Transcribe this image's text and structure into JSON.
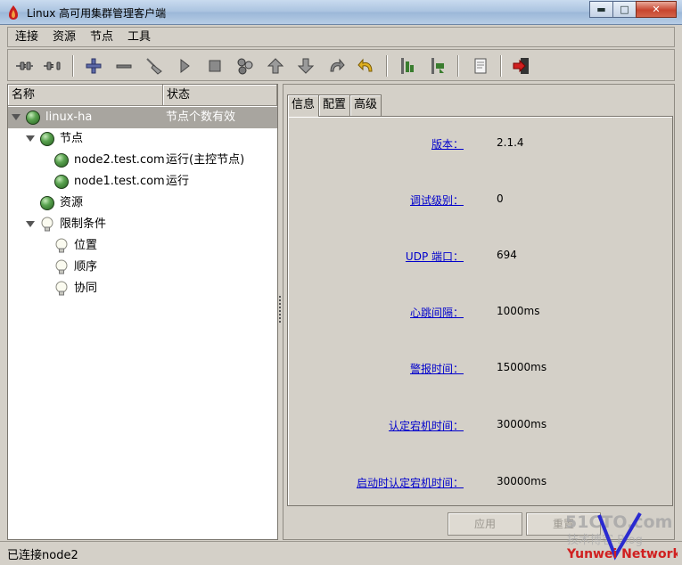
{
  "window": {
    "title": "Linux 高可用集群管理客户端",
    "minimize": "▬",
    "maximize": "□",
    "close": "✕"
  },
  "menu": [
    "连接",
    "资源",
    "节点",
    "工具"
  ],
  "toolbar_icons": [
    "connect-icon",
    "disconnect-icon",
    "add-icon",
    "remove-icon",
    "cleanup-icon",
    "start-icon",
    "stop-icon",
    "migrate-icon",
    "move-up-icon",
    "move-down-icon",
    "redo-icon",
    "undo-icon",
    "standby-icon",
    "active-icon",
    "view-log-icon",
    "exit-icon"
  ],
  "tree": {
    "col_name": "名称",
    "col_status": "状态",
    "rows": [
      {
        "label": "linux-ha",
        "status": "节点个数有效",
        "level": 0,
        "icon": "green-ball",
        "expanded": true,
        "selected": true
      },
      {
        "label": "节点",
        "status": "",
        "level": 1,
        "icon": "green-ball",
        "expanded": true
      },
      {
        "label": "node2.test.com",
        "status": "运行(主控节点)",
        "level": 2,
        "icon": "green-ball"
      },
      {
        "label": "node1.test.com",
        "status": "运行",
        "level": 2,
        "icon": "green-ball"
      },
      {
        "label": "资源",
        "status": "",
        "level": 1,
        "icon": "green-ball"
      },
      {
        "label": "限制条件",
        "status": "",
        "level": 1,
        "icon": "bulb",
        "expanded": true
      },
      {
        "label": "位置",
        "status": "",
        "level": 2,
        "icon": "bulb"
      },
      {
        "label": "顺序",
        "status": "",
        "level": 2,
        "icon": "bulb"
      },
      {
        "label": "协同",
        "status": "",
        "level": 2,
        "icon": "bulb"
      }
    ]
  },
  "tabs": [
    {
      "label": "信息",
      "active": true
    },
    {
      "label": "配置",
      "active": false
    },
    {
      "label": "高级",
      "active": false
    }
  ],
  "properties": [
    {
      "label": "版本：",
      "value": "2.1.4"
    },
    {
      "label": "调试级别：",
      "value": "0"
    },
    {
      "label": "UDP 端口：",
      "value": "694"
    },
    {
      "label": "心跳间隔：",
      "value": "1000ms"
    },
    {
      "label": "警报时间：",
      "value": "15000ms"
    },
    {
      "label": "认定宕机时间：",
      "value": "30000ms"
    },
    {
      "label": "启动时认定宕机时间：",
      "value": "30000ms"
    }
  ],
  "buttons": {
    "apply": "应用",
    "reset": "重置"
  },
  "status": "已连接node2",
  "watermark": {
    "line1": "51CTO.com",
    "line2": "技术博客 Blog",
    "line3": "Yunwei Network"
  },
  "colors": {
    "selected_row": "#a8a59f",
    "link": "#0000cc",
    "panel": "#d4d0c8"
  }
}
